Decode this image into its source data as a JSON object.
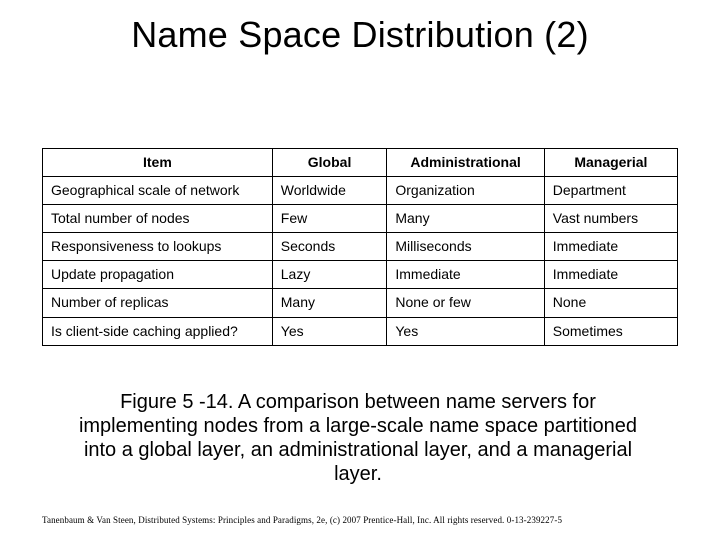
{
  "title": "Name Space Distribution (2)",
  "table": {
    "headers": [
      "Item",
      "Global",
      "Administrational",
      "Managerial"
    ],
    "rows": [
      [
        "Geographical scale of network",
        "Worldwide",
        "Organization",
        "Department"
      ],
      [
        "Total number of nodes",
        "Few",
        "Many",
        "Vast numbers"
      ],
      [
        "Responsiveness to lookups",
        "Seconds",
        "Milliseconds",
        "Immediate"
      ],
      [
        "Update propagation",
        "Lazy",
        "Immediate",
        "Immediate"
      ],
      [
        "Number of replicas",
        "Many",
        "None or few",
        "None"
      ],
      [
        "Is client-side caching applied?",
        "Yes",
        "Yes",
        "Sometimes"
      ]
    ]
  },
  "caption": "Figure 5 -14. A comparison between name servers for implementing nodes from a large-scale name space partitioned into a global layer, an administrational layer, and a managerial layer.",
  "footer": "Tanenbaum & Van Steen, Distributed Systems: Principles and Paradigms, 2e, (c) 2007 Prentice-Hall, Inc. All rights reserved. 0-13-239227-5"
}
